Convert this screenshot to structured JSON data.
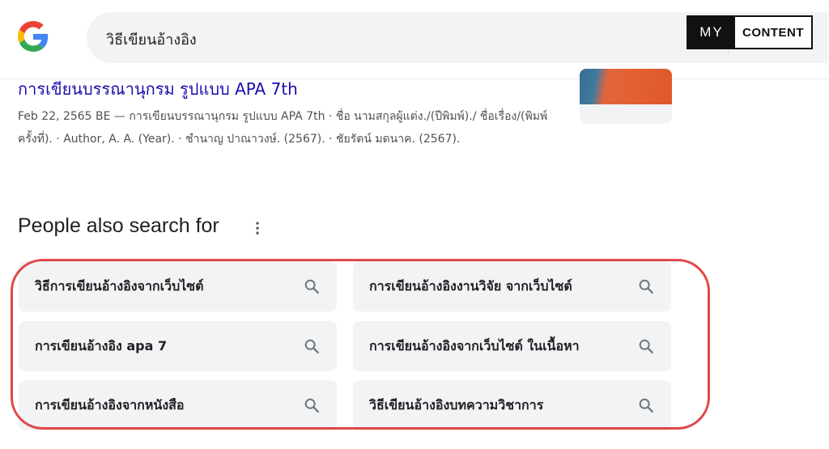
{
  "search": {
    "query": "วิธีเขียนอ้างอิง"
  },
  "watermark": {
    "left": "MY",
    "right": "CONTENT"
  },
  "result": {
    "title": "การเขียนบรรณานุกรม รูปแบบ APA 7th",
    "snippet": "Feb 22, 2565 BE — การเขียนบรรณานุกรม รูปแบบ APA 7th · ชื่อ นามสกุลผู้แต่ง./(ปีพิมพ์)./ ชื่อเรื่อง/(พิมพ์ครั้งที่). · Author, A. A. (Year). · ชำนาญ ปาณาวงษ์. (2567). · ชัยรัตน์ มดนาค. (2567)."
  },
  "people_also_search": {
    "heading": "People also search for",
    "items": [
      "วิธีการเขียนอ้างอิงจากเว็บไซต์",
      "การเขียนอ้างอิงงานวิจัย จากเว็บไซต์",
      "การเขียนอ้างอิง apa 7",
      "การเขียนอ้างอิงจากเว็บไซต์ ในเนื้อหา",
      "การเขียนอ้างอิงจากหนังสือ",
      "วิธีเขียนอ้างอิงบทความวิชาการ"
    ]
  },
  "colors": {
    "link": "#1a0dab",
    "chip_bg": "#f1f3f4",
    "highlight": "#e04848",
    "google_blue": "#4285f4",
    "google_red": "#ea4335",
    "google_yellow": "#fbbc05",
    "google_green": "#34a853"
  },
  "icons": [
    "google-logo",
    "microphone-icon",
    "lens-icon",
    "more-vert-icon",
    "search-icon"
  ]
}
